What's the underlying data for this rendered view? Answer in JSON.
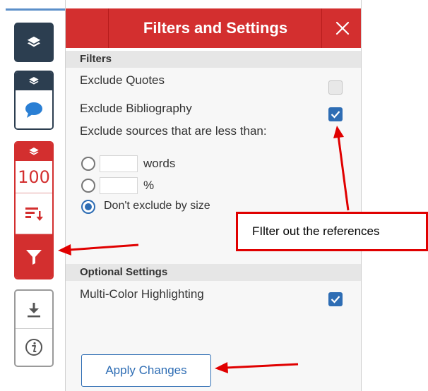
{
  "panel": {
    "title": "Filters and Settings",
    "close_icon": "close-icon",
    "filters_header": "Filters",
    "exclude_quotes": {
      "label": "Exclude Quotes",
      "checked": false
    },
    "exclude_bibliography": {
      "label": "Exclude Bibliography",
      "checked": true
    },
    "exclude_sources_label": "Exclude sources that are less than:",
    "size_options": [
      {
        "unit": "words",
        "value": "",
        "selected": false
      },
      {
        "unit": "%",
        "value": "",
        "selected": false
      },
      {
        "label": "Don't exclude by size",
        "selected": true
      }
    ],
    "optional_header": "Optional Settings",
    "multi_color": {
      "label": "Multi-Color Highlighting",
      "checked": true
    },
    "apply_label": "Apply Changes"
  },
  "rail": {
    "score": "100",
    "icons": [
      "layers-icon",
      "comment-icon",
      "sort-icon",
      "filter-icon",
      "download-icon",
      "info-icon"
    ]
  },
  "annotation": {
    "callout_text": "FIlter out the references"
  },
  "colors": {
    "accent_red": "#d32f2f",
    "rail_dark": "#2c3e50",
    "checkbox_blue": "#2e6db4",
    "annotation_red": "#e00000"
  }
}
